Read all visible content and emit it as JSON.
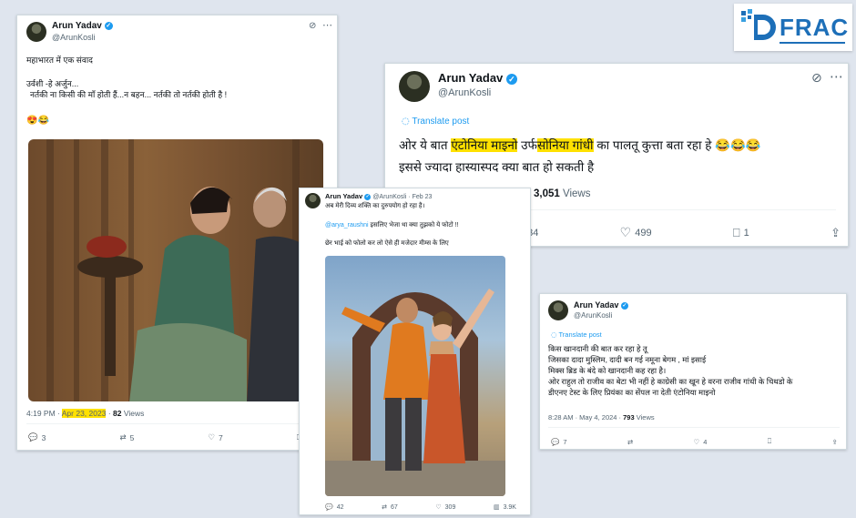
{
  "logo": {
    "text": "FRAC",
    "icon": "dfrac-shield-logo"
  },
  "card1": {
    "name": "Arun Yadav",
    "handle": "@ArunKosli",
    "line1": "महाभारत में एक संवाद",
    "line2": "उर्वशी -हे अर्जुन...",
    "line3": "नर्तकी ना किसी की माँ होती हैं...न बहन... नर्तकी तो नर्तकी होती है !",
    "emoji": "😍😂",
    "time": "4:19 PM ·",
    "date": "Apr 23, 2023",
    "views_num": "82",
    "views_label": "Views",
    "replies": "3",
    "reposts": "5",
    "likes": "7"
  },
  "card2": {
    "name": "Arun Yadav",
    "handle": "@ArunKosli",
    "translate": "Translate post",
    "t_pre": "ओर ये बात",
    "t_hl1": "एंटोनिया माइनो",
    "t_mid": "उर्फ",
    "t_hl2": "सोनिया गांधी",
    "t_post": "का पालतू कुत्ता बता रहा हे 😂😂😂",
    "line2": "इससे ज्यादा हास्यास्पद क्या बात हो सकती है",
    "views_num": "3,051",
    "views_label": "Views",
    "replies": "134",
    "likes": "499",
    "bookmarks": "1"
  },
  "card3": {
    "name": "Arun Yadav",
    "handle": "@ArunKosli · Feb 23",
    "line1": "अब मेरी दिव्य शक्ति का दुरुपयोग हो रहा है।",
    "line2_mention": "@arya_raushni",
    "line2": "इसलिए भेजा था क्या तुझको ये फोटो !!",
    "line3": "छेर भाई को फोलो कर लो ऐसे ही मजेदार मीम्स के लिए",
    "replies": "42",
    "reposts": "67",
    "likes": "309",
    "views": "3.9K"
  },
  "card4": {
    "name": "Arun Yadav",
    "handle": "@ArunKosli",
    "translate": "Translate post",
    "lines": [
      "किस खानदानी की बात कर रहा हे तू",
      "जिसका दादा मुस्लिम, दादी बन गई नमूना बेगम , मां इसाई",
      "मिक्स ब्रिड के बंदे को खानदानी कह रहा है।",
      "ओर राहुल तो राजीव का बेटा भी नहीं हे काग्रेसी का खून हे वरना राजीव गांधी के चिथडो के",
      "डीएनए टेस्ट के लिए प्रियंका का सेंपल ना देती एंटोनिया माइनो"
    ],
    "time": "8:28 AM · May 4, 2024 ·",
    "views_num": "793",
    "views_label": "Views",
    "replies": "7",
    "likes": "4"
  }
}
